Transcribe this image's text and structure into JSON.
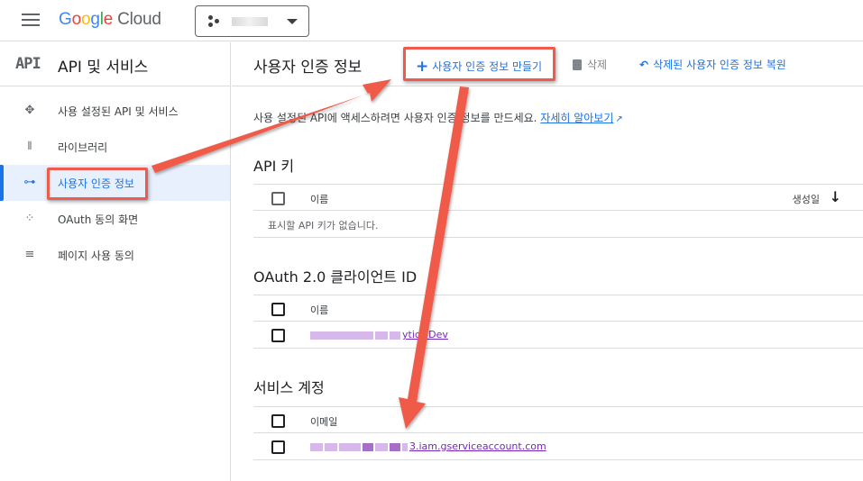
{
  "header": {
    "brand_letters": [
      "G",
      "o",
      "o",
      "g",
      "l",
      "e"
    ],
    "brand_cloud": "Cloud",
    "project_name": ""
  },
  "sidebar": {
    "logo_text": "API",
    "title": "API 및 서비스",
    "items": [
      {
        "label": "사용 설정된 API 및 서비스",
        "icon": "enabled-apis-icon"
      },
      {
        "label": "라이브러리",
        "icon": "library-icon"
      },
      {
        "label": "사용자 인증 정보",
        "icon": "key-icon",
        "active": true
      },
      {
        "label": "OAuth 동의 화면",
        "icon": "oauth-consent-icon"
      },
      {
        "label": "페이지 사용 동의",
        "icon": "page-usage-agreement-icon"
      }
    ]
  },
  "toolbar": {
    "title": "사용자 인증 정보",
    "create_label": "사용자 인증 정보 만들기",
    "delete_label": "삭제",
    "restore_label": "삭제된 사용자 인증 정보 복원"
  },
  "intro": {
    "text": "사용 설정된 API에 액세스하려면 사용자 인증 정보를 만드세요.",
    "link": "자세히 알아보기"
  },
  "api_keys": {
    "title": "API 키",
    "col_name": "이름",
    "col_created": "생성일",
    "empty": "표시할 API 키가 없습니다."
  },
  "oauth": {
    "title": "OAuth 2.0 클라이언트 ID",
    "col_name": "이름",
    "rows": [
      {
        "name_suffix": "ytics Dev"
      }
    ]
  },
  "service_accounts": {
    "title": "서비스 계정",
    "col_email": "이메일",
    "rows": [
      {
        "email_suffix": "3.iam.gserviceaccount.com"
      }
    ]
  },
  "colors": {
    "accent": "#1a73e8",
    "annotation": "#ef5a4a",
    "visited_link": "#7627bb"
  }
}
